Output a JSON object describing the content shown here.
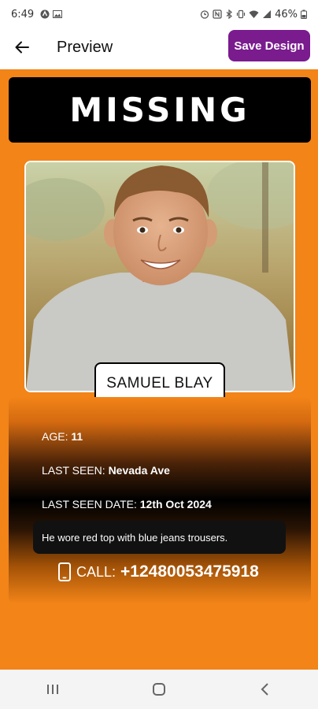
{
  "status_bar": {
    "time": "6:49",
    "battery": "46%",
    "left_icons": [
      "notification-icon",
      "image-icon"
    ],
    "right_icons": [
      "alarm-icon",
      "nfc-icon",
      "bluetooth-icon",
      "vibrate-icon",
      "wifi-icon",
      "signal-icon",
      "battery-icon"
    ]
  },
  "app_bar": {
    "title": "Preview",
    "save_label": "Save Design",
    "back_icon": "arrow-left-icon"
  },
  "poster": {
    "heading": "MISSING",
    "name": "SAMUEL BLAY",
    "age_label": "AGE:",
    "age_value": "11",
    "last_seen_label": "LAST SEEN:",
    "last_seen_value": "Nevada Ave",
    "last_seen_date_label": "LAST SEEN DATE:",
    "last_seen_date_value": "12th Oct 2024",
    "description": "He wore red top with blue jeans trousers.",
    "call_label": "CALL:",
    "phone": "+12480053475918",
    "call_icon": "phone-icon",
    "colors": {
      "background": "#f28418",
      "banner": "#000000",
      "accent_button": "#7a1b8e"
    }
  },
  "nav_bar": {
    "icons": [
      "recent-apps-icon",
      "home-icon",
      "back-icon"
    ]
  }
}
